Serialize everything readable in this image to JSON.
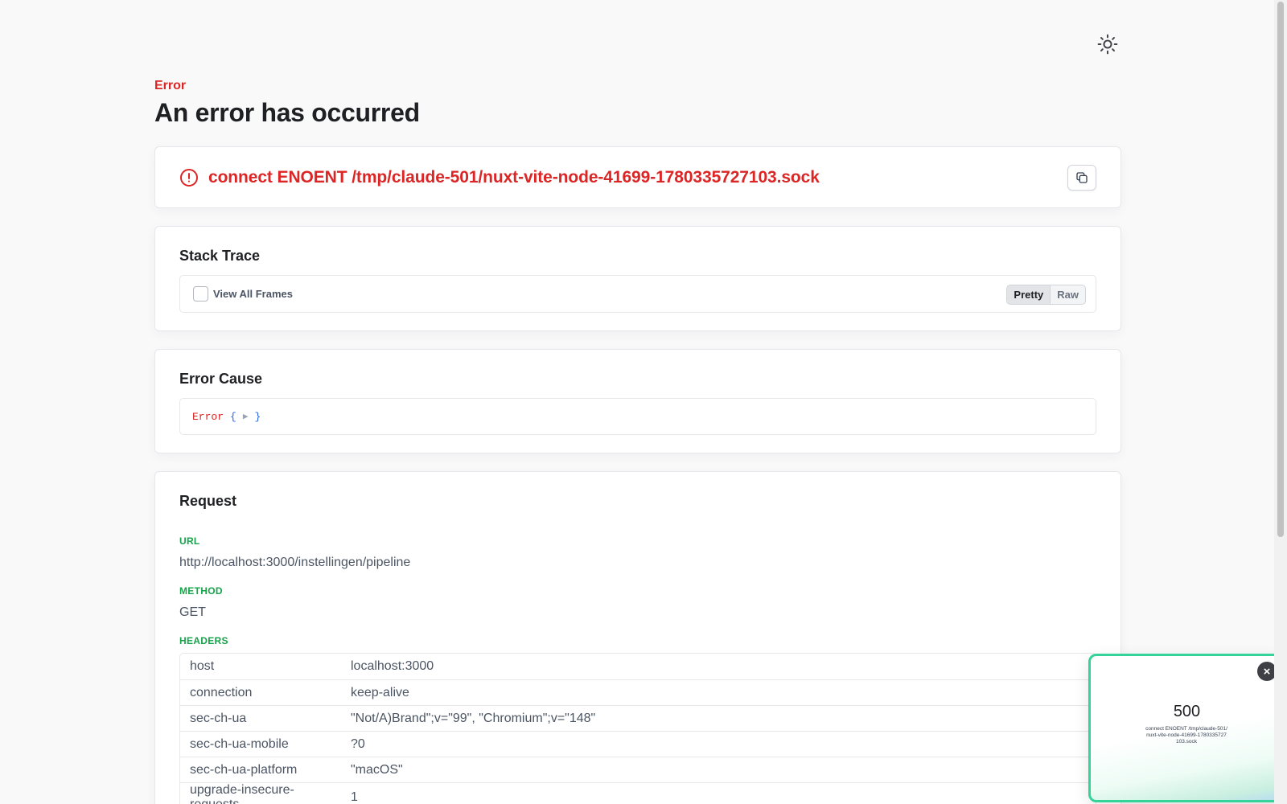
{
  "header": {
    "eyebrow": "Error",
    "title": "An error has occurred"
  },
  "theme_toggle": {
    "icon": "sun-icon"
  },
  "error": {
    "message": "connect ENOENT /tmp/claude-501/nuxt-vite-node-41699-1780335727103.sock",
    "icon": "alert-circle-icon",
    "copy_icon": "copy-icon"
  },
  "stack_trace": {
    "title": "Stack Trace",
    "view_all_label": "View All Frames",
    "view_all_checked": false,
    "modes": [
      "Pretty",
      "Raw"
    ],
    "active_mode": "Pretty"
  },
  "error_cause": {
    "title": "Error Cause",
    "name": "Error",
    "open_brace": "{",
    "expand": "▶",
    "close_brace": "}"
  },
  "request": {
    "title": "Request",
    "url_label": "URL",
    "url": "http://localhost:3000/instellingen/pipeline",
    "method_label": "METHOD",
    "method": "GET",
    "headers_label": "HEADERS",
    "headers": [
      {
        "key": "host",
        "value": "localhost:3000"
      },
      {
        "key": "connection",
        "value": "keep-alive"
      },
      {
        "key": "sec-ch-ua",
        "value": "\"Not/A)Brand\";v=\"99\", \"Chromium\";v=\"148\""
      },
      {
        "key": "sec-ch-ua-mobile",
        "value": "?0"
      },
      {
        "key": "sec-ch-ua-platform",
        "value": "\"macOS\""
      },
      {
        "key": "upgrade-insecure-requests",
        "value": "1"
      }
    ]
  },
  "preview": {
    "code": "500",
    "message": "connect ENOENT /tmp/claude-501/nuxt-vite-node-41699-1780335727103.sock",
    "close": "×",
    "accent": "#34d399"
  },
  "colors": {
    "error": "#dc2626",
    "label_green": "#16a34a",
    "link_blue": "#2563eb"
  }
}
